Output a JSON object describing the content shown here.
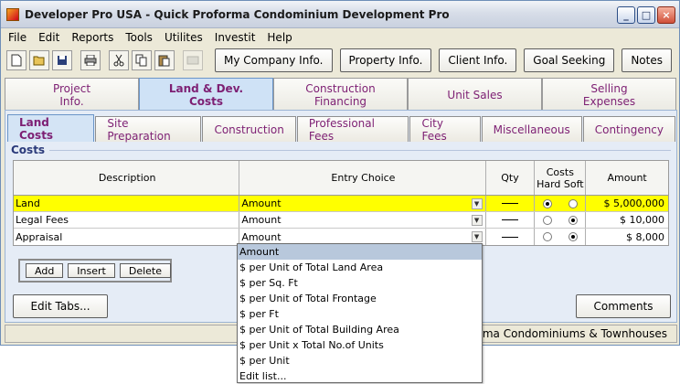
{
  "window": {
    "title": "Developer Pro  USA - Quick Proforma Condominium Development Pro"
  },
  "window_controls": {
    "minimize": "_",
    "maximize": "□",
    "close": "×"
  },
  "menu": [
    "File",
    "Edit",
    "Reports",
    "Tools",
    "Utilites",
    "Investit",
    "Help"
  ],
  "toolbar": {
    "icons": [
      "new-file-icon",
      "open-folder-icon",
      "save-disk-icon",
      "print-icon",
      "cut-scissors-icon",
      "copy-icon",
      "paste-icon",
      "disabled-tool-icon"
    ],
    "buttons": [
      "My Company Info.",
      "Property Info.",
      "Client Info.",
      "Goal Seeking",
      "Notes"
    ]
  },
  "main_tabs": [
    {
      "line1": "Project",
      "line2": "Info."
    },
    {
      "line1": "Land & Dev.",
      "line2": "Costs"
    },
    {
      "line1": "Construction",
      "line2": "Financing"
    },
    {
      "line1": "Unit Sales",
      "line2": ""
    },
    {
      "line1": "Selling",
      "line2": "Expenses"
    }
  ],
  "sub_tabs": [
    "Land Costs",
    "Site Preparation",
    "Construction",
    "Professional Fees",
    "City Fees",
    "Miscellaneous",
    "Contingency"
  ],
  "section_label": "Costs",
  "table": {
    "headers": {
      "description": "Description",
      "entry": "Entry Choice",
      "qty": "Qty",
      "costs": "Costs",
      "hard_soft": "Hard Soft",
      "amount": "Amount"
    },
    "rows": [
      {
        "description": "Land",
        "entry": "Amount",
        "hard": true,
        "amount": "$ 5,000,000"
      },
      {
        "description": "Legal Fees",
        "entry": "Amount",
        "hard": false,
        "amount": "$ 10,000"
      },
      {
        "description": "Appraisal",
        "entry": "Amount",
        "hard": false,
        "amount": "$ 8,000"
      }
    ]
  },
  "row_buttons": {
    "add": "Add",
    "insert": "Insert",
    "delete": "Delete"
  },
  "bottom_buttons": {
    "edit_tabs": "Edit Tabs...",
    "comments": "Comments"
  },
  "status": {
    "text": "rma Condominiums & Townhouses"
  },
  "dropdown": {
    "items": [
      "Amount",
      "$ per Unit of Total Land Area",
      "$ per Sq. Ft",
      "$ per Unit of Total Frontage",
      "$ per Ft",
      "$ per Unit of Total Building Area",
      "$ per Unit x Total No.of Units",
      "$ per Unit",
      "Edit list..."
    ]
  }
}
